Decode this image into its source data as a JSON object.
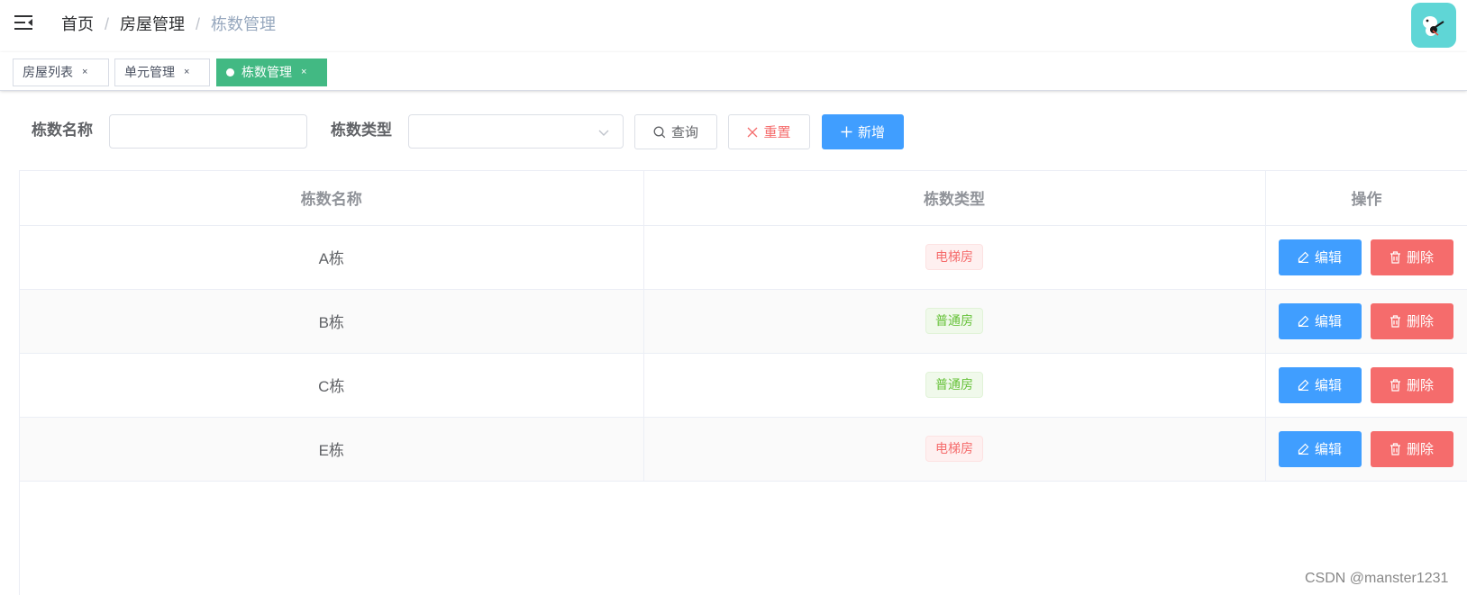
{
  "breadcrumb": [
    "首页",
    "房屋管理",
    "栋数管理"
  ],
  "tabs": [
    {
      "label": "房屋列表",
      "close": "×"
    },
    {
      "label": "单元管理",
      "close": "×"
    },
    {
      "label": "栋数管理",
      "close": "×",
      "active": true
    }
  ],
  "search": {
    "name_label": "栋数名称",
    "name_value": "",
    "type_label": "栋数类型",
    "type_value": "",
    "query_label": "查询",
    "reset_label": "重置",
    "add_label": "新增"
  },
  "table": {
    "columns": [
      "栋数名称",
      "栋数类型",
      "操作"
    ],
    "rows": [
      {
        "name": "A栋",
        "type": "电梯房",
        "type_kind": "elevator"
      },
      {
        "name": "B栋",
        "type": "普通房",
        "type_kind": "normal"
      },
      {
        "name": "C栋",
        "type": "普通房",
        "type_kind": "normal"
      },
      {
        "name": "E栋",
        "type": "电梯房",
        "type_kind": "elevator"
      }
    ],
    "edit_label": "编辑",
    "delete_label": "删除"
  },
  "colors": {
    "primary": "#409eff",
    "danger": "#f56c6c",
    "success": "#67c23a",
    "active_tab": "#42b983"
  },
  "watermark": "CSDN @manster1231"
}
